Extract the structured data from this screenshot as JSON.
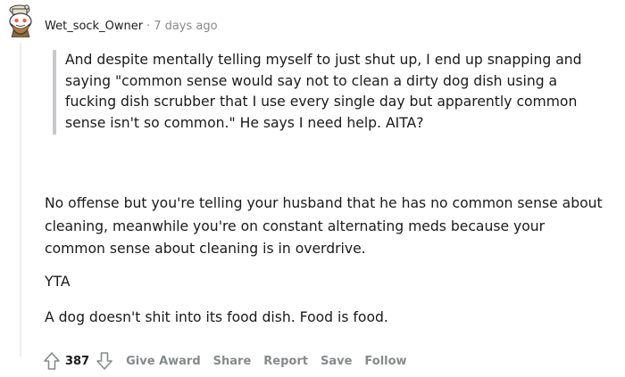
{
  "comment": {
    "author": "Wet_sock_Owner",
    "separator": "·",
    "timestamp": "7 days ago",
    "quote_lines": [
      "And despite mentally telling myself to just shut up, I end up snapping and",
      "saying \"common sense would say not to clean a dirty dog dish using a",
      "fucking dish scrubber that I use every single day but apparently common",
      "sense isn't so common.\" He says I need help. AITA?"
    ],
    "paragraph_lines": [
      "No offense but you're telling your husband that he has no common sense about",
      "cleaning, meanwhile you're on constant alternating meds because your",
      "common sense about cleaning is in overdrive."
    ],
    "verdict": "YTA",
    "closing": "A dog doesn't shit into its food dish. Food is food.",
    "score": "387",
    "actions": {
      "give_award": "Give Award",
      "share": "Share",
      "report": "Report",
      "save": "Save",
      "follow": "Follow"
    },
    "icons": {
      "avatar": "snoo-avatar-icon",
      "upvote": "upvote-arrow-icon",
      "downvote": "downvote-arrow-icon"
    },
    "colors": {
      "meta_gray": "#878a8c",
      "quote_bar": "#c6c8cb",
      "text": "#1a1a1b"
    }
  }
}
